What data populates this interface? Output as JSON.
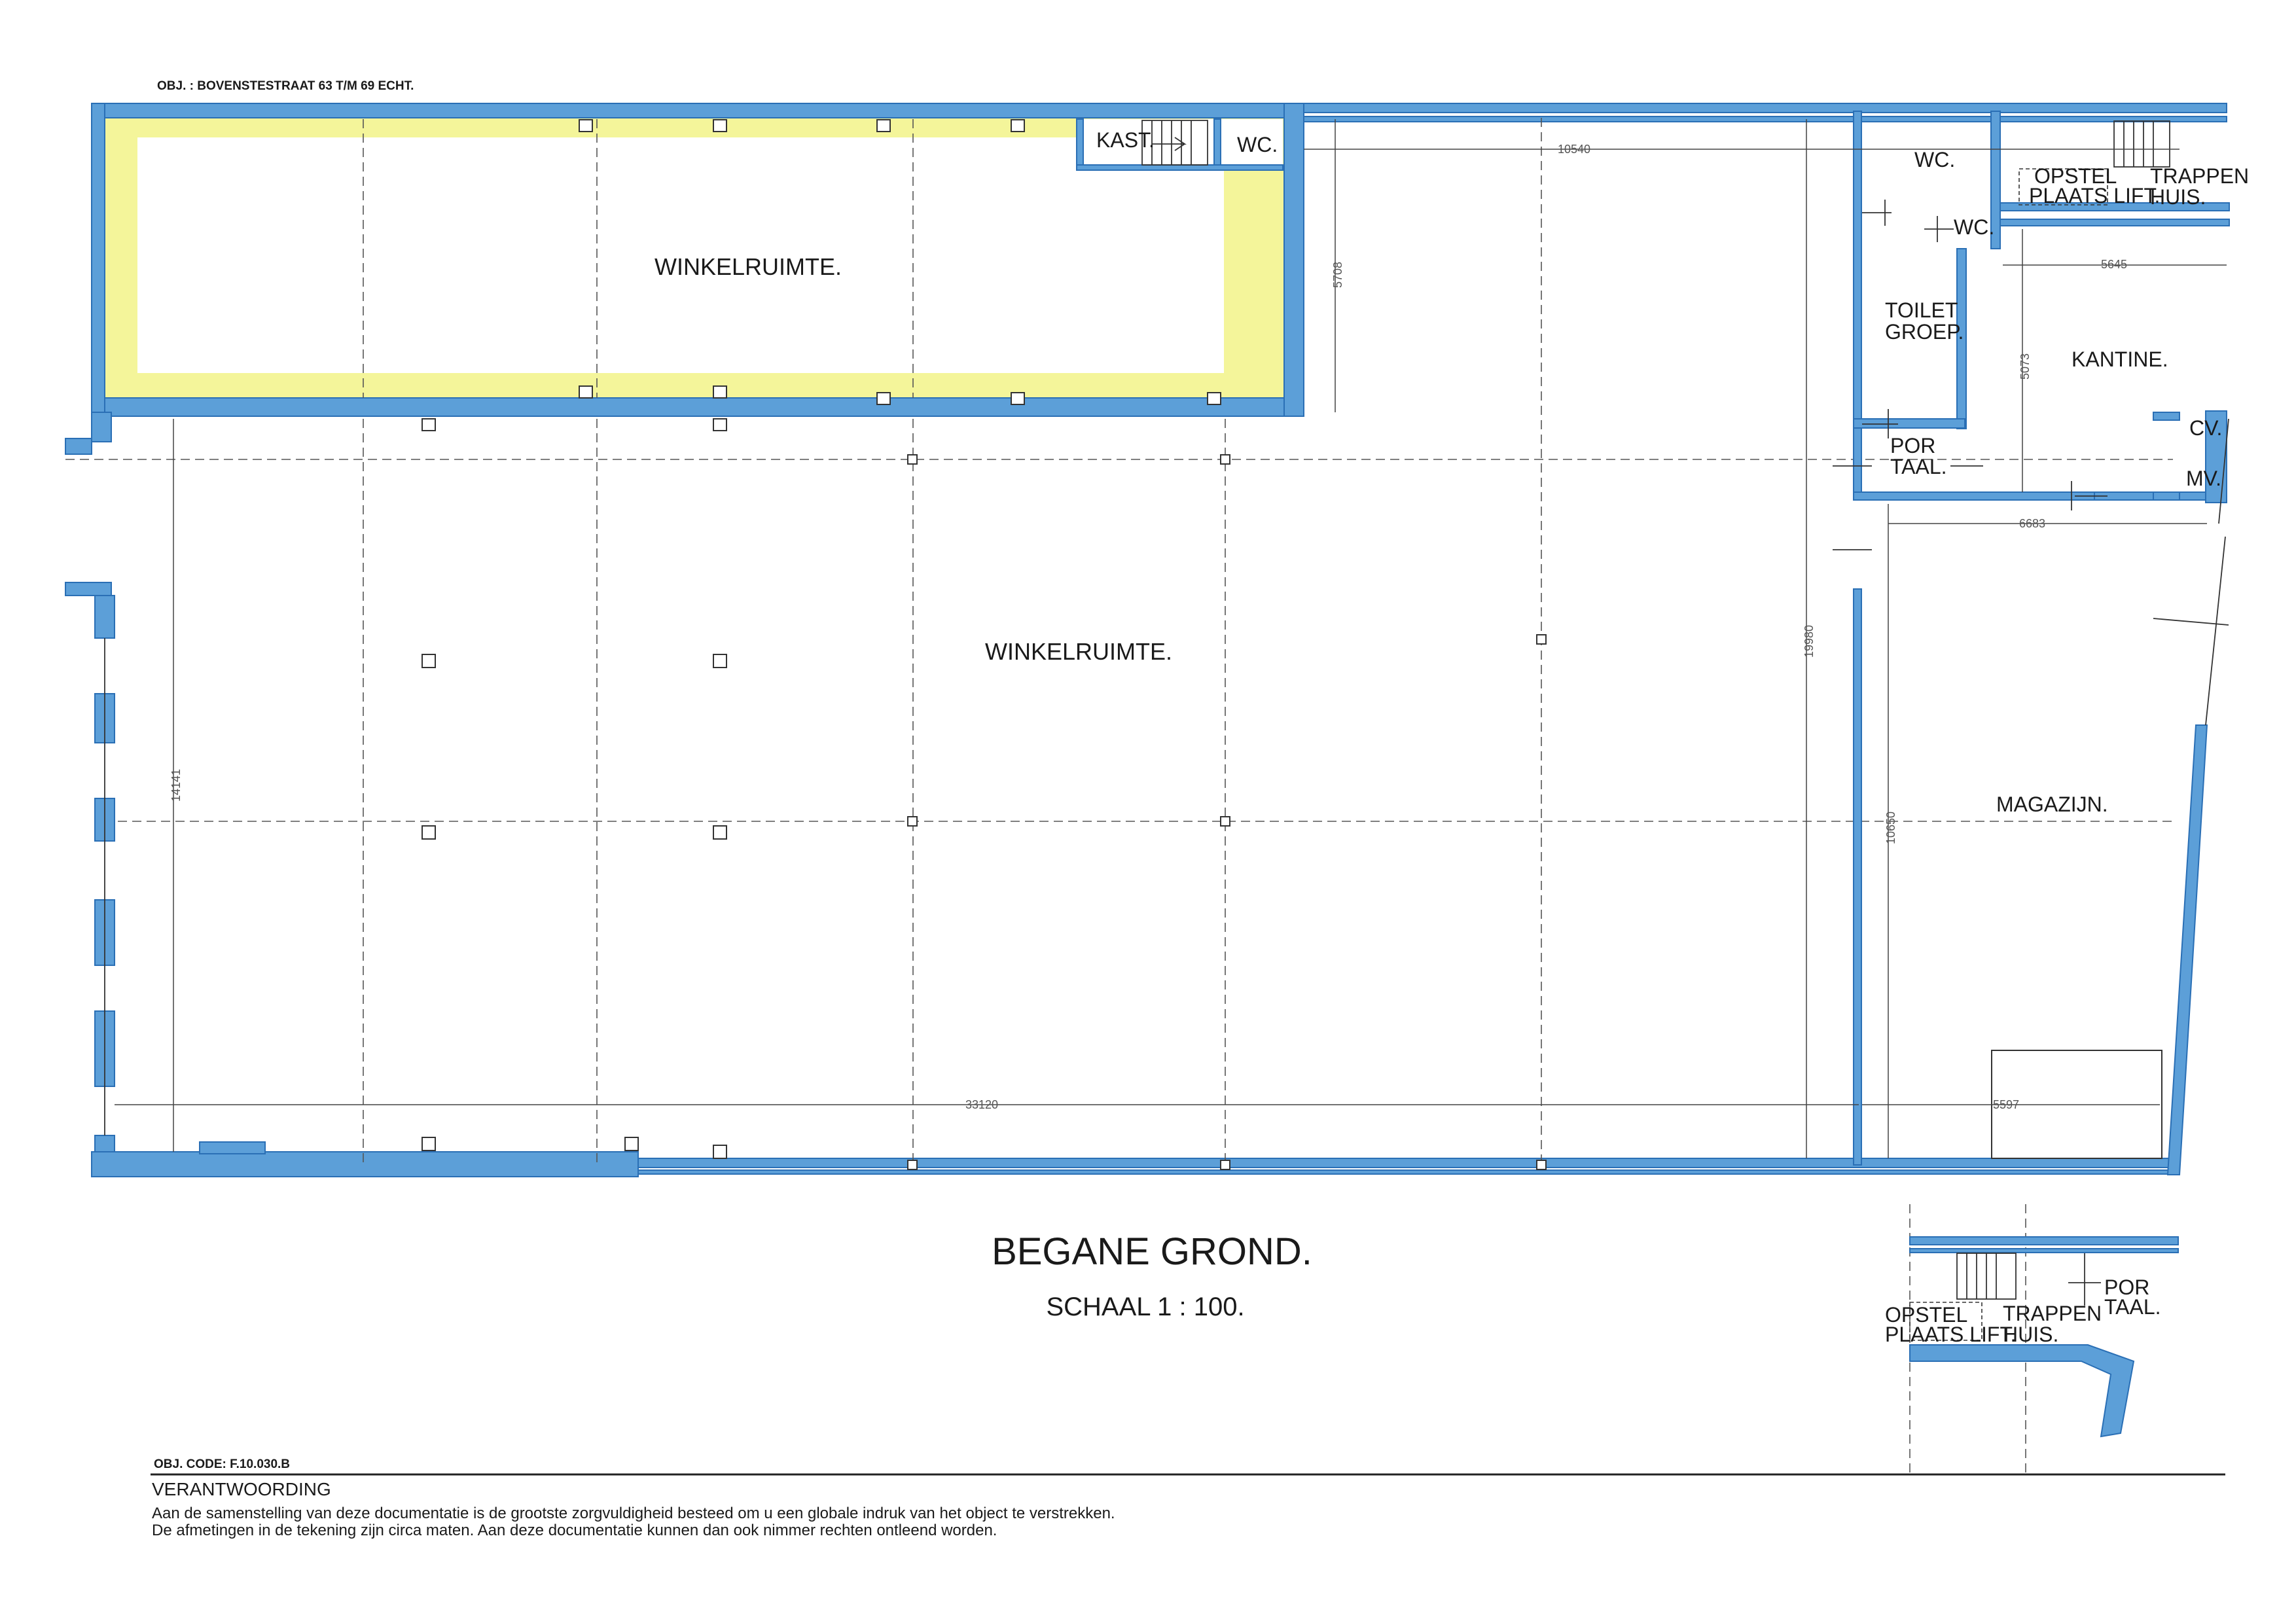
{
  "header": {
    "object_label": "OBJ. :  BOVENSTESTRAAT 63 T/M 69 ECHT."
  },
  "rooms": {
    "shop_upper": "WINKELRUIMTE.",
    "shop_main": "WINKELRUIMTE.",
    "kast": "KAST.",
    "wc_small": "WC.",
    "wc_right": "WC.",
    "wc_right2": "WC.",
    "opstel_1": "OPSTEL",
    "opstel_2": "PLAATS LIFT.",
    "trappen_1": "TRAPPEN",
    "trappen_2": "HUIS.",
    "toilet_1": "TOILET",
    "toilet_2": "GROEP.",
    "kantine": "KANTINE.",
    "portaal_1": "POR",
    "portaal_2": "TAAL.",
    "cv": "CV.",
    "mv": "MV.",
    "magazijn": "MAGAZIJN."
  },
  "dimensions": {
    "d10540": "10540",
    "d5708": "5708",
    "d5645": "5645",
    "d5073": "5073",
    "d6683": "6683",
    "d19980": "19980",
    "d10650": "10650",
    "d14141": "14141",
    "d33120": "33120",
    "d5597": "5597"
  },
  "title": {
    "main": "BEGANE GROND.",
    "scale": "SCHAAL 1 :  100."
  },
  "inset": {
    "opstel_1": "OPSTEL",
    "opstel_2": "PLAATS LIFT.",
    "trappen_1": "TRAPPEN",
    "trappen_2": "HUIS.",
    "portaal_1": "POR",
    "portaal_2": "TAAL."
  },
  "footer": {
    "code": "OBJ. CODE: F.10.030.B",
    "heading": "VERANTWOORDING",
    "line1": "Aan de samenstelling van deze documentatie is de grootste zorgvuldigheid besteed om u een globale indruk van het object te verstrekken.",
    "line2": "De afmetingen in de tekening zijn circa maten. Aan deze documentatie kunnen dan ook nimmer rechten ontleend worden."
  },
  "colors": {
    "wall": "#5c9fd8",
    "highlight": "#f4f59a",
    "line": "#333333"
  }
}
